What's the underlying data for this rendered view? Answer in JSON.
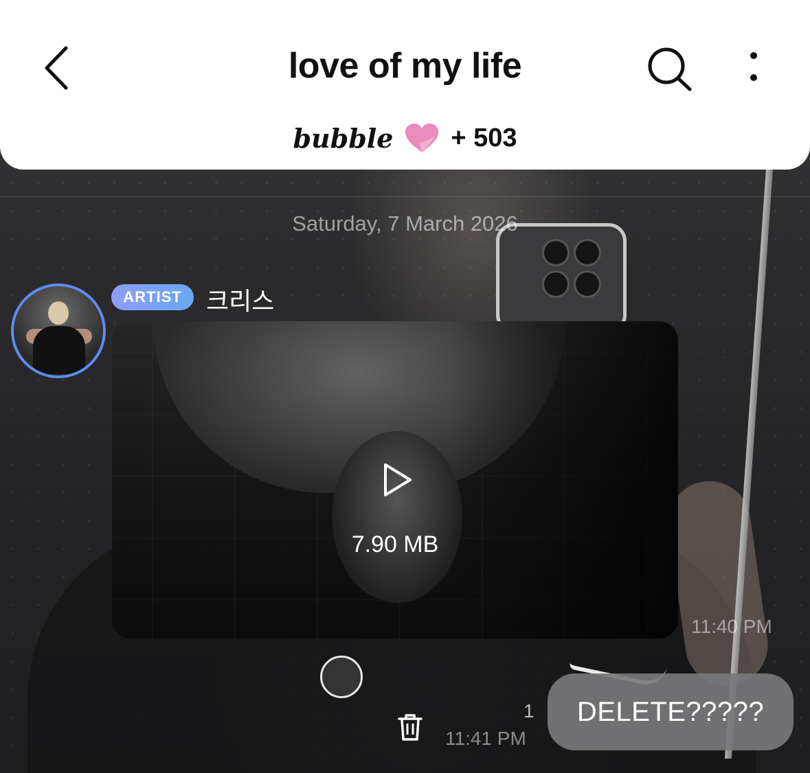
{
  "header": {
    "title": "love of my life",
    "brand": "bubble",
    "subscriber_count": "+ 503",
    "icons": {
      "back": "chevron-left-icon",
      "search": "search-icon",
      "more": "more-vertical-icon",
      "heart": "heart-icon"
    },
    "heart_color": "#e98bbd"
  },
  "chat": {
    "date_divider": "Saturday, 7 March 2026",
    "incoming": {
      "badge": "ARTIST",
      "sender_name": "크리스",
      "badge_color": "#7fa2f4",
      "avatar_ring_color": "#5d8cf0",
      "video": {
        "file_size": "7.90 MB",
        "icon": "play-icon"
      },
      "time": "11:40 PM"
    },
    "outgoing": {
      "text": "DELETE?????",
      "read_count": "1",
      "time": "11:41 PM",
      "delete_icon": "trash-icon"
    }
  }
}
